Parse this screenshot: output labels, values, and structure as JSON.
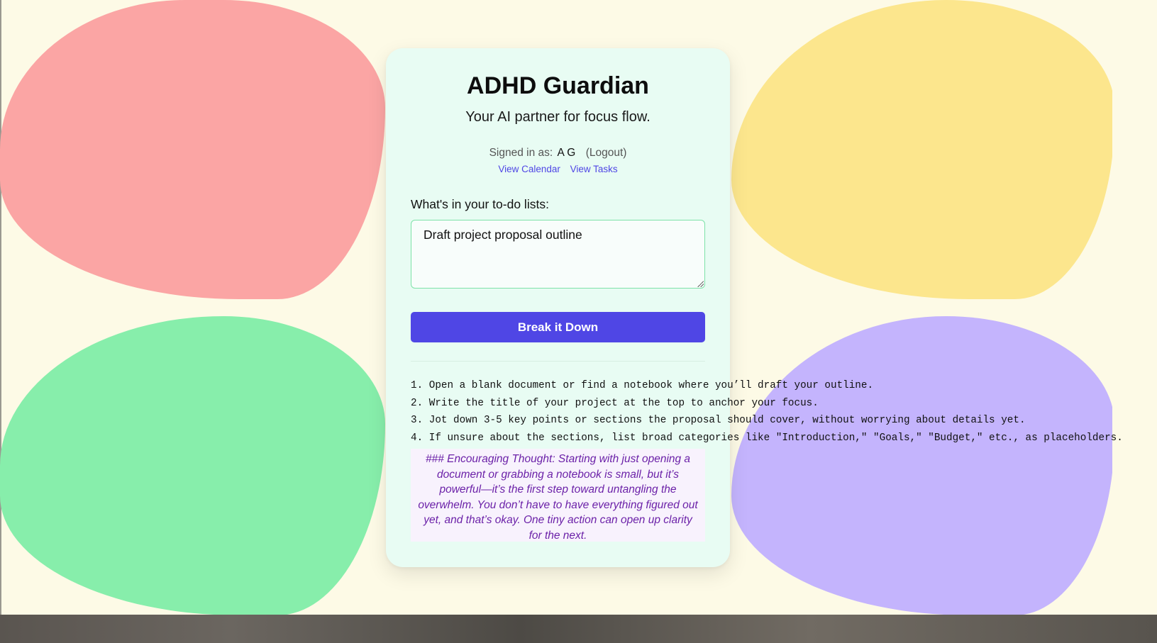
{
  "app": {
    "title": "ADHD Guardian",
    "tagline": "Your AI partner for focus flow."
  },
  "account": {
    "signed_in_label": "Signed in as:",
    "user_name": "A G",
    "logout_label": "(Logout)"
  },
  "nav": {
    "calendar_link": "View Calendar",
    "tasks_link": "View Tasks"
  },
  "todo": {
    "label": "What's in your to-do lists:",
    "value": "Draft project proposal outline"
  },
  "action": {
    "break_label": "Break it Down"
  },
  "result": {
    "steps": [
      "1. Open a blank document or find a notebook where you’ll draft your outline.",
      "2. Write the title of your project at the top to anchor your focus.",
      "3. Jot down 3-5 key points or sections the proposal should cover, without worrying about details yet.",
      "4. If unsure about the sections, list broad categories like \"Introduction,\" \"Goals,\" \"Budget,\" etc., as placeholders."
    ],
    "encouragement": "### Encouraging Thought: Starting with just opening a document or grabbing a notebook is small, but it’s powerful—it’s the first step toward untangling the overwhelm. You don’t have to have everything figured out yet, and that’s okay. One tiny action can open up clarity for the next."
  },
  "theme": {
    "background": "#fdfae6",
    "card": "#e8fcf3",
    "accent": "#4f46e5",
    "blob_red": "#fba5a4",
    "blob_yellow": "#fce68d",
    "blob_green": "#87eeab",
    "blob_purple": "#c4b4fd",
    "encouragement_text": "#6b21a8"
  }
}
